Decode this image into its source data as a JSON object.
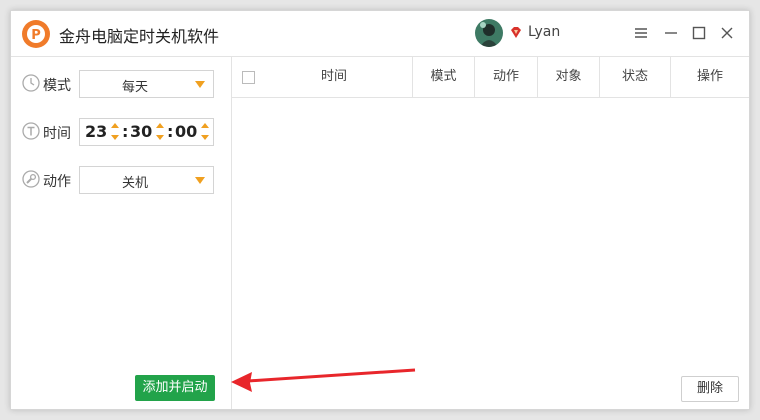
{
  "app": {
    "title": "金舟电脑定时关机软件",
    "username": "Lyan",
    "accent_color": "#22a34a",
    "arrow_color": "#e8262b",
    "icons": {
      "logo": "app-logo-icon",
      "vip": "vip-badge-icon",
      "menu": "menu-icon",
      "minimize": "minimize-icon",
      "maximize": "maximize-icon",
      "close": "close-icon"
    }
  },
  "form": {
    "mode": {
      "label": "模式",
      "value": "每天",
      "icon": "clock-icon"
    },
    "time": {
      "label": "时间",
      "hour": "23",
      "minute": "30",
      "second": "00",
      "sep": ":",
      "icon": "time-icon"
    },
    "action": {
      "label": "动作",
      "value": "关机",
      "icon": "wrench-icon"
    },
    "submit_label": "添加并启动"
  },
  "table": {
    "columns": [
      "时间",
      "模式",
      "动作",
      "对象",
      "状态",
      "操作"
    ],
    "rows": [],
    "delete_label": "删除"
  }
}
